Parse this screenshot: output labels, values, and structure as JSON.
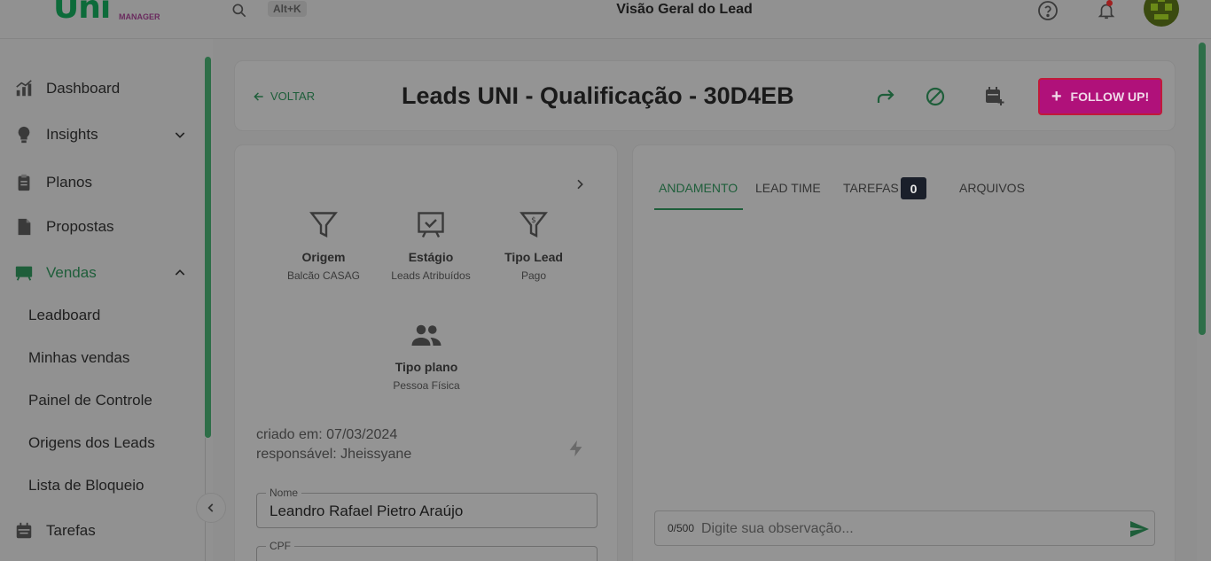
{
  "topbar": {
    "logo": "Uni",
    "logo_sub": "MANAGER",
    "shortcut": "Alt+K",
    "title": "Visão Geral do Lead"
  },
  "sidebar": {
    "items": [
      {
        "label": "Dashboard",
        "icon": "chart-icon"
      },
      {
        "label": "Insights",
        "icon": "lightbulb-icon"
      },
      {
        "label": "Planos",
        "icon": "clipboard-icon"
      },
      {
        "label": "Propostas",
        "icon": "document-icon"
      },
      {
        "label": "Vendas",
        "icon": "presentation-icon"
      },
      {
        "label": "Tarefas",
        "icon": "calendar-icon"
      }
    ],
    "subitems": [
      "Leadboard",
      "Minhas vendas",
      "Painel de Controle",
      "Origens dos Leads",
      "Lista de Bloqueio"
    ]
  },
  "header": {
    "back_label": "VOLTAR",
    "lead_title": "Leads UNI - Qualificação - 30D4EB",
    "follow_label": "FOLLOW UP!"
  },
  "left": {
    "stats": [
      {
        "title": "Origem",
        "value": "Balcão CASAG"
      },
      {
        "title": "Estágio",
        "value": "Leads Atribuídos"
      },
      {
        "title": "Tipo Lead",
        "value": "Pago"
      },
      {
        "title": "Tipo plano",
        "value": "Pessoa Física"
      }
    ],
    "created": "criado em: 07/03/2024",
    "responsible": "responsável: Jheissyane",
    "name_label": "Nome",
    "name_value": "Leandro Rafael Pietro Araújo",
    "cpf_label": "CPF"
  },
  "right": {
    "tabs": [
      "ANDAMENTO",
      "LEAD TIME",
      "TAREFAS",
      "ARQUIVOS"
    ],
    "tasks_count": "0",
    "obs_counter": "0/500",
    "obs_placeholder": "Digite sua observação..."
  },
  "colors": {
    "accent": "#1e5e3a",
    "follow_button": "#b0117a"
  }
}
